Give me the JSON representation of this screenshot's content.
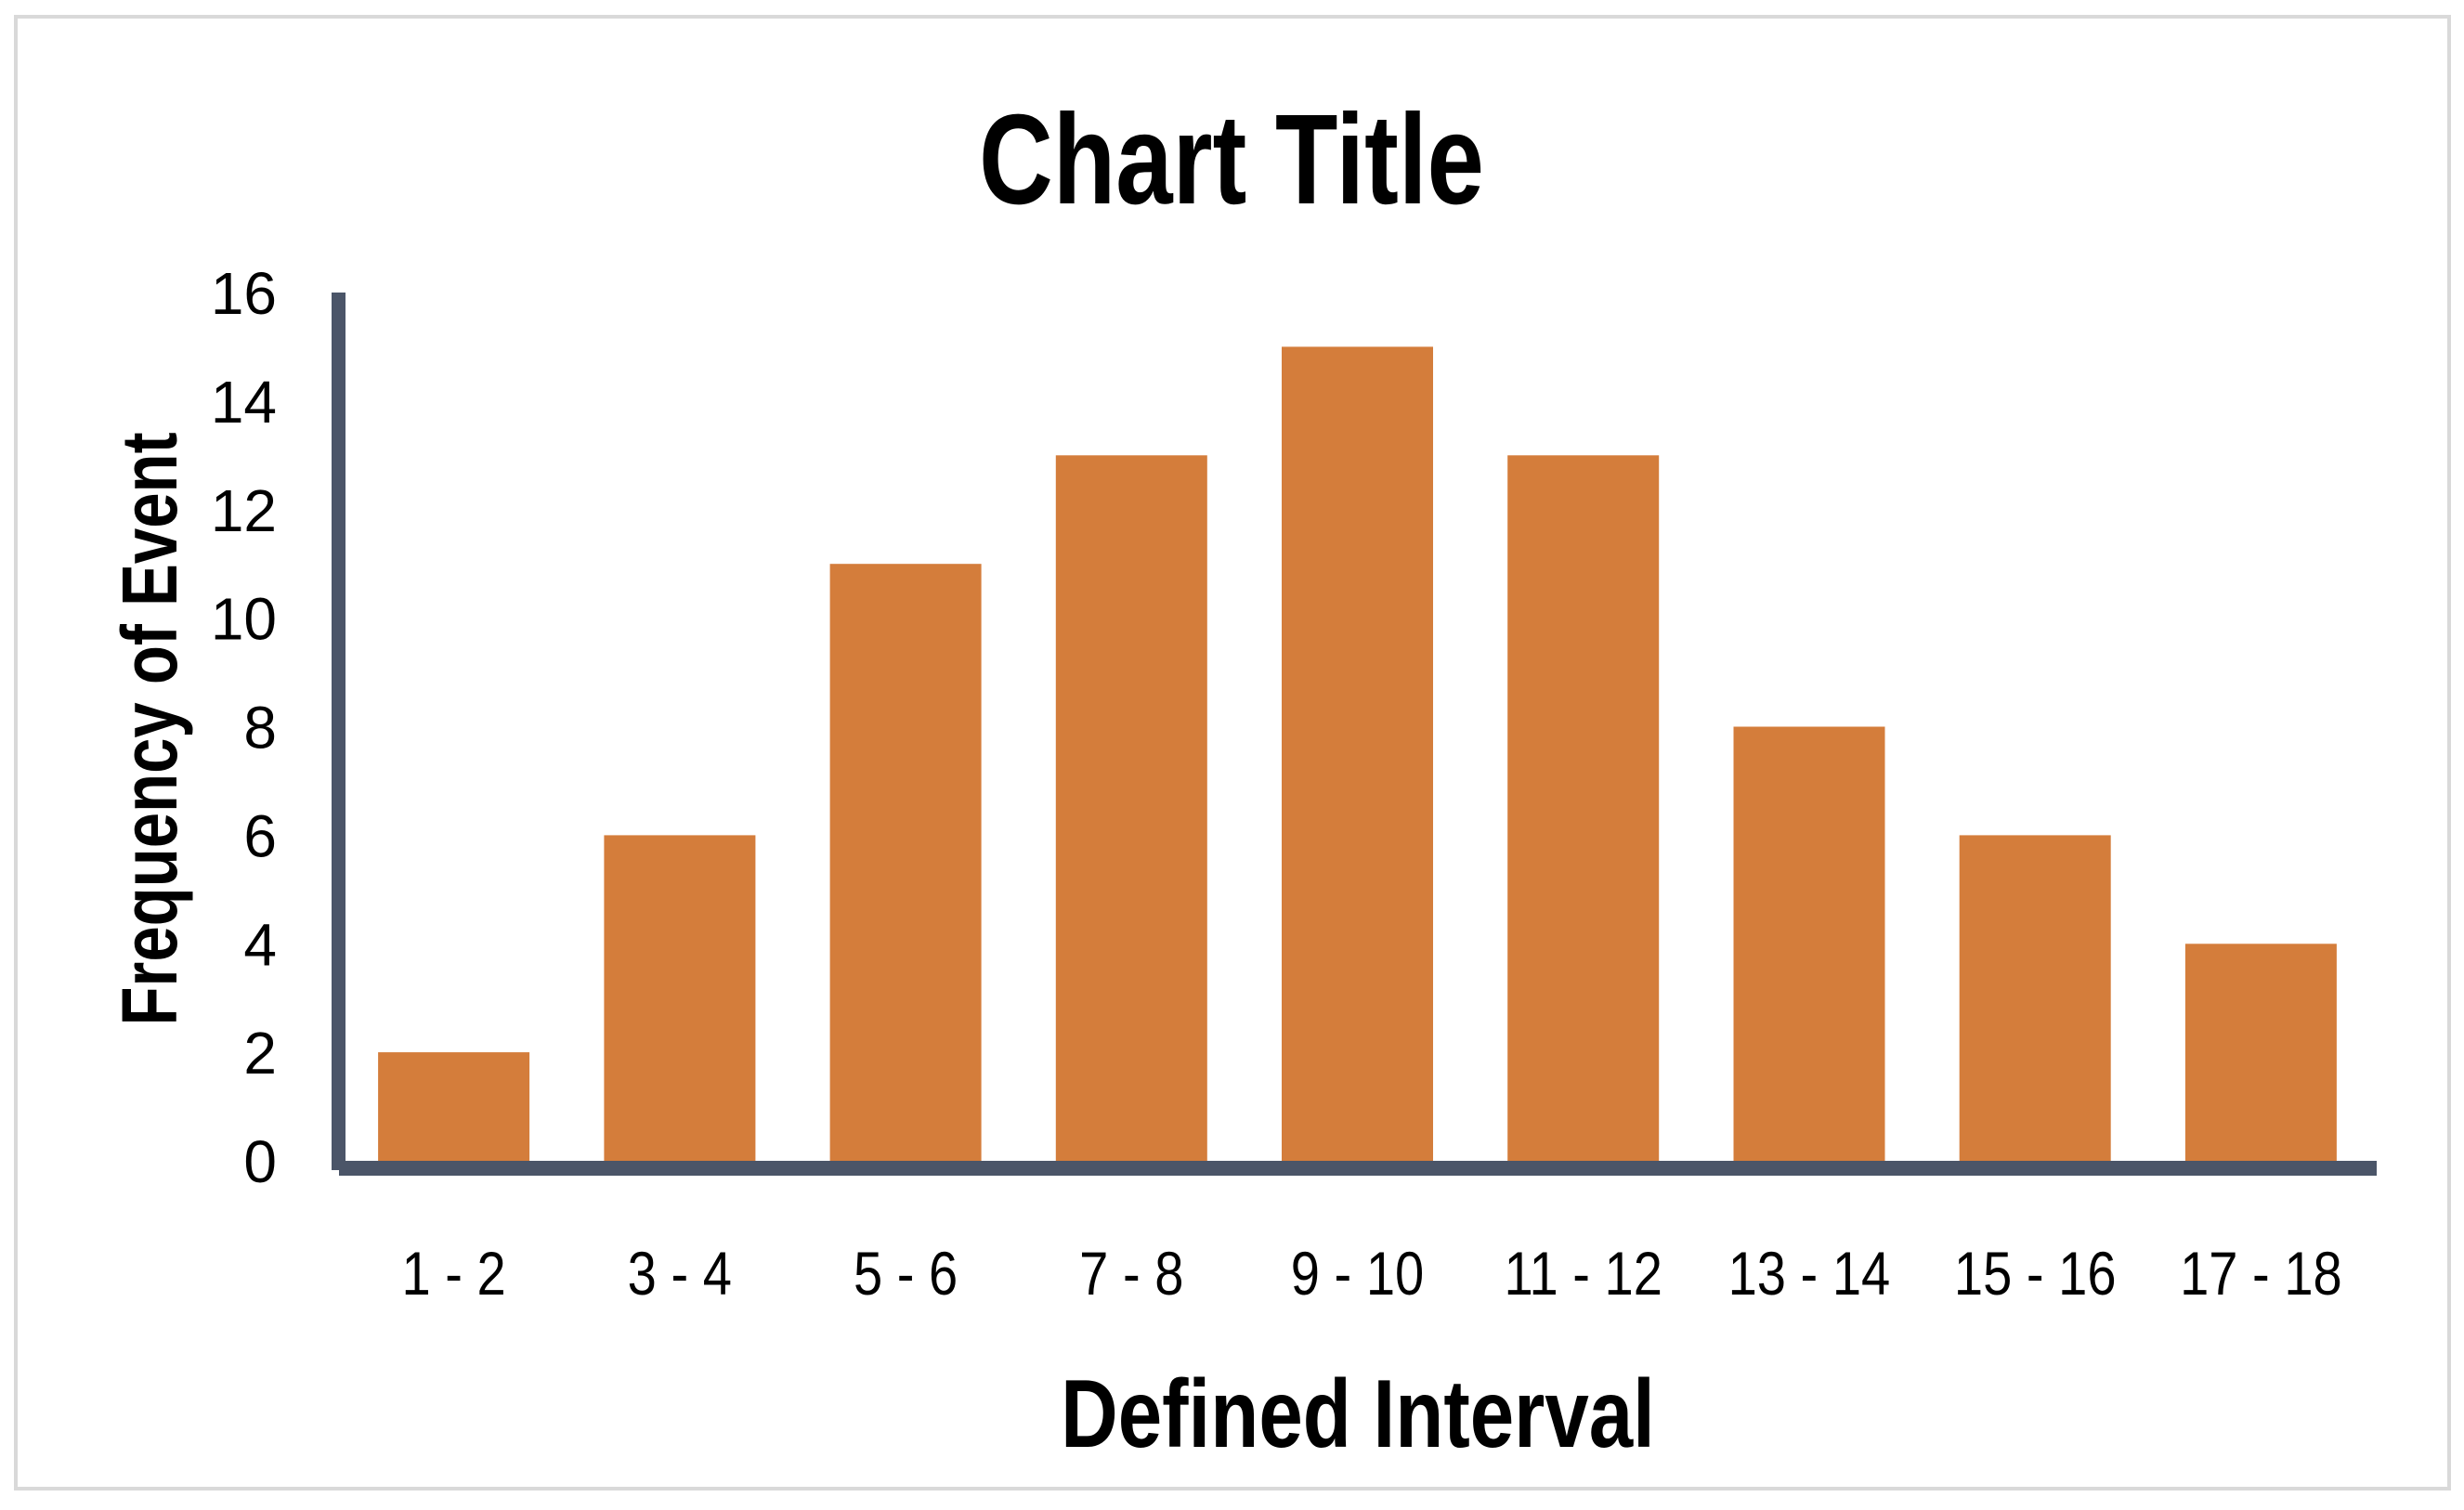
{
  "chart_data": {
    "type": "bar",
    "title": "Chart Title",
    "xlabel": "Defined Interval",
    "ylabel": "Frequency of Event",
    "categories": [
      "1 - 2",
      "3 - 4",
      "5 - 6",
      "7 - 8",
      "9 - 10",
      "11 - 12",
      "13 - 14",
      "15 - 16",
      "17 - 18"
    ],
    "values": [
      2,
      6,
      11,
      13,
      15,
      13,
      8,
      6,
      4
    ],
    "ylim": [
      0,
      16
    ],
    "yticks": [
      0,
      2,
      4,
      6,
      8,
      10,
      12,
      14,
      16
    ],
    "grid": false,
    "legend": "none",
    "colors": {
      "bar": "#D47D3B",
      "axis": "#4B5568",
      "border": "#D9D9D9",
      "text": "#000000"
    }
  }
}
